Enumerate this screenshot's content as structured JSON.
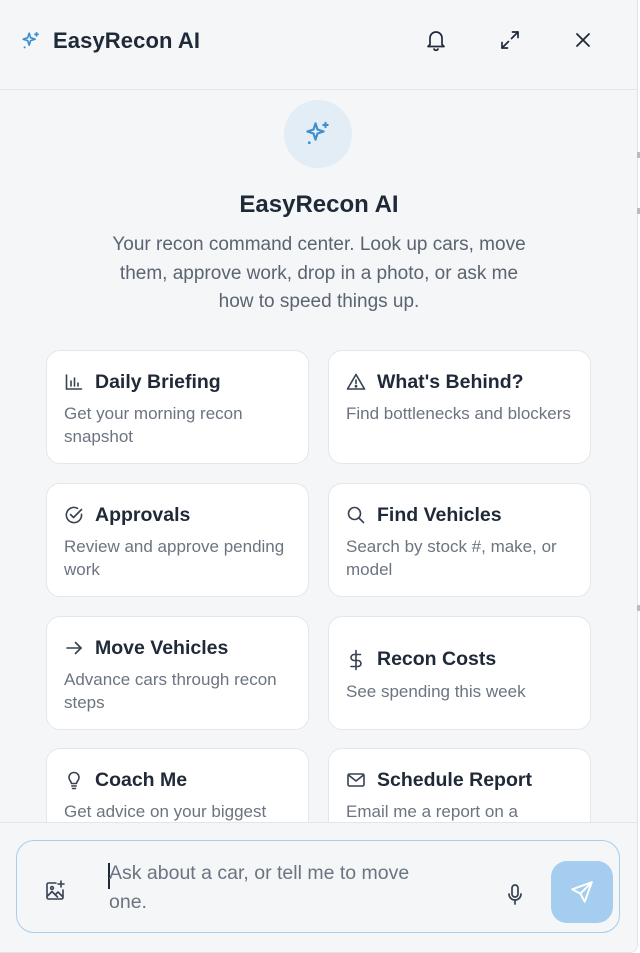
{
  "header": {
    "title": "EasyRecon AI",
    "icons": {
      "brand": "sparkles-icon",
      "bell": "bell-icon",
      "expand": "expand-icon",
      "close": "close-icon"
    }
  },
  "hero": {
    "icon": "sparkles-icon",
    "title": "EasyRecon AI",
    "subtitle": "Your recon command center. Look up cars, move them, approve work, drop in a photo, or ask me how to speed things up."
  },
  "cards": [
    {
      "icon": "bar-chart-icon",
      "title": "Daily Briefing",
      "desc": "Get your morning recon snapshot"
    },
    {
      "icon": "warning-triangle-icon",
      "title": "What's Behind?",
      "desc": "Find bottlenecks and blockers"
    },
    {
      "icon": "check-circle-icon",
      "title": "Approvals",
      "desc": "Review and approve pending work"
    },
    {
      "icon": "search-icon",
      "title": "Find Vehicles",
      "desc": "Search by stock #, make, or model"
    },
    {
      "icon": "arrow-right-icon",
      "title": "Move Vehicles",
      "desc": "Advance cars through recon steps"
    },
    {
      "icon": "dollar-icon",
      "title": "Recon Costs",
      "desc": "See spending this week"
    },
    {
      "icon": "lightbulb-icon",
      "title": "Coach Me",
      "desc": "Get advice on your biggest"
    },
    {
      "icon": "mail-icon",
      "title": "Schedule Report",
      "desc": "Email me a report on a"
    }
  ],
  "composer": {
    "placeholder": "Ask about a car, or tell me to move one.",
    "icons": {
      "image": "image-add-icon",
      "mic": "microphone-icon",
      "send": "send-icon"
    }
  },
  "colors": {
    "accent": "#3b8ed0",
    "send_bg": "#a4cdef",
    "panel_bg": "#f4f6f8"
  }
}
